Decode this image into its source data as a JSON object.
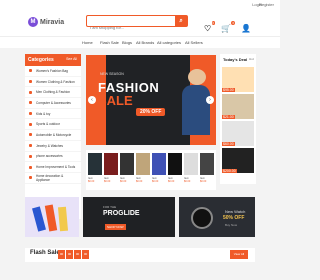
{
  "topbar": {
    "login": "Login",
    "register": "Register"
  },
  "header": {
    "logo_mark": "M",
    "logo": "Miravia",
    "search_placeholder": "I am shopping for..."
  },
  "icons": {
    "search": "⌕",
    "heart": "♡",
    "cart": "🛒",
    "user": "👤",
    "wish_count": "0",
    "cart_count": "0"
  },
  "nav": [
    "Home",
    "Flash Sale",
    "Blogs",
    "All Brands",
    "All categories",
    "All Sellers"
  ],
  "categories": {
    "title": "Categories",
    "view_all": "See All",
    "items": [
      "Women's Fashion Bag",
      "Women Clothing & Fashion",
      "Men Clothing & Fashion",
      "Computer & Accessories",
      "Kids & toy",
      "Sports & outdoor",
      "Automobile & Motorcycle",
      "Jewelry & Watches",
      "phone accessories",
      "Home Improvement & Tools",
      "Home decoration & Appliance"
    ]
  },
  "banner": {
    "tag": "NEW SEASON",
    "line1": "FASHION",
    "line2": "SALE",
    "discount": "20% OFF"
  },
  "today": {
    "title": "Today's Deal",
    "hot": "Hot",
    "prices": [
      "$95.00",
      "$21.00",
      "$60.00",
      "$200.00"
    ]
  },
  "strip": [
    {
      "label": "Item",
      "price": "$0.00"
    },
    {
      "label": "Item",
      "price": "$0.00"
    },
    {
      "label": "Item",
      "price": "$0.00"
    },
    {
      "label": "Item",
      "price": "$0.00"
    },
    {
      "label": "Item",
      "price": "$0.00"
    },
    {
      "label": "Item",
      "price": "$0.00"
    },
    {
      "label": "Item",
      "price": "$0.00"
    },
    {
      "label": "Item",
      "price": "$0.00"
    }
  ],
  "promo2": {
    "small": "FOR THE",
    "title": "PROGLIDE",
    "button": "SHOP NOW"
  },
  "promo3": {
    "small": "New Watch",
    "title": "50% OFF",
    "sub": "Buy Now"
  },
  "flash": {
    "title": "Flash Sale",
    "view_all": "View All",
    "timer": [
      "00",
      "00",
      "00",
      "00"
    ]
  },
  "colors": {
    "accent": "#f05a28",
    "banner_bg": "#202225"
  }
}
